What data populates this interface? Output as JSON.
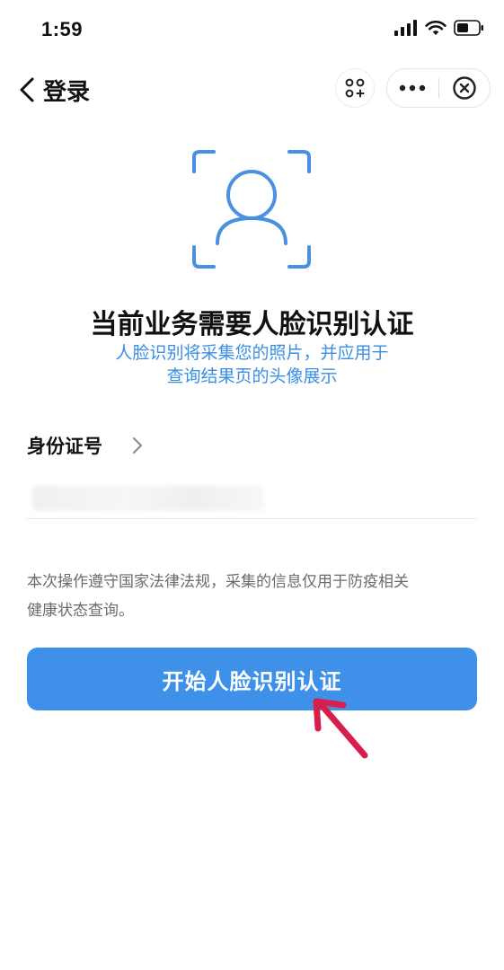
{
  "status_bar": {
    "time": "1:59",
    "icons": [
      "signal-icon",
      "wifi-icon",
      "battery-icon"
    ]
  },
  "nav": {
    "title": "登录",
    "icons": [
      "back-chevron-icon",
      "scan-icon",
      "more-icon",
      "close-icon"
    ]
  },
  "hero": {
    "title": "当前业务需要人脸识别认证",
    "subtitle_line1": "人脸识别将采集您的照片，并应用于",
    "subtitle_line2": "查询结果页的头像展示",
    "icon": "face-frame-icon"
  },
  "form": {
    "id_label": "身份证号"
  },
  "notice": {
    "line1": "本次操作遵守国家法律法规，采集的信息仅用于防疫相关",
    "line2": "健康状态查询。"
  },
  "button": {
    "label": "开始人脸识别认证"
  },
  "colors": {
    "accent": "#3e90e8",
    "subtitle": "#3a8ee6",
    "face_icon": "#4a90e2",
    "arrow": "#d81f4c"
  }
}
